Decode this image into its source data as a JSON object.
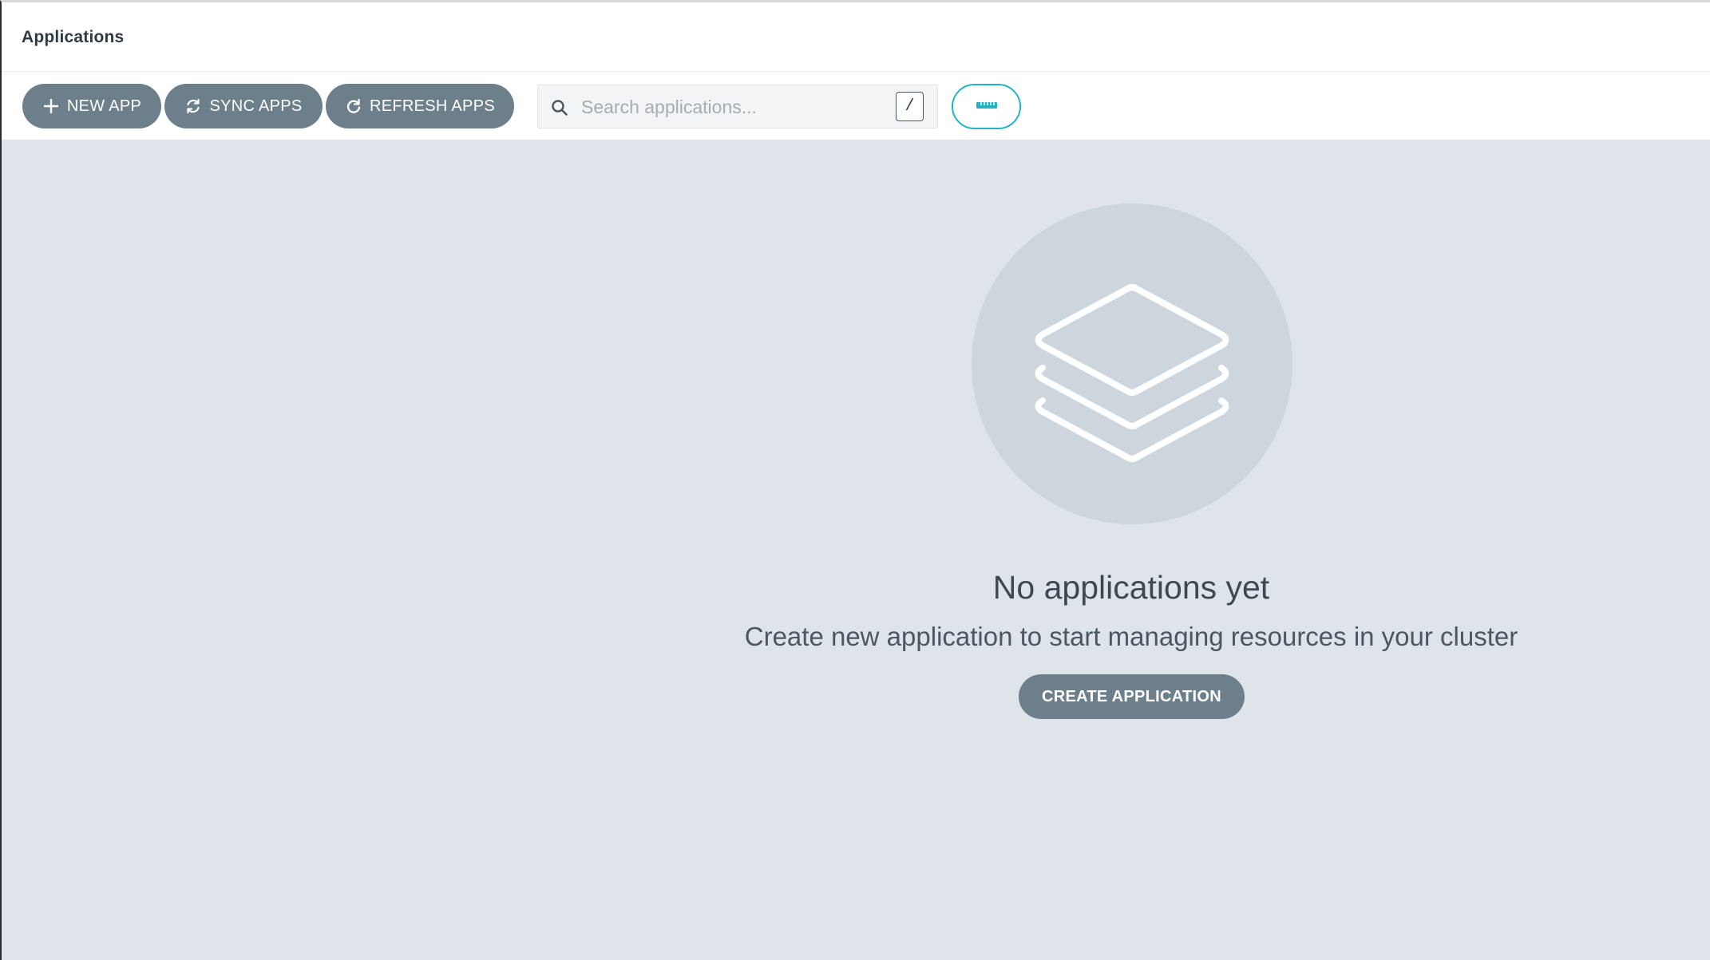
{
  "header": {
    "title": "Applications"
  },
  "toolbar": {
    "new_app": {
      "label": "NEW APP",
      "icon": "plus-icon"
    },
    "sync_apps": {
      "label": "SYNC APPS",
      "icon": "sync-icon"
    },
    "refresh_apps": {
      "label": "REFRESH APPS",
      "icon": "refresh-icon"
    },
    "search": {
      "placeholder": "Search applications...",
      "value": "",
      "shortcut": "/",
      "icon": "search-icon"
    },
    "view_toggle": {
      "icon": "view-mode-icon",
      "accent": "#22b3c5"
    }
  },
  "empty_state": {
    "icon": "layers-icon",
    "title": "No applications yet",
    "subtitle": "Create new application to start managing resources in your cluster",
    "create_button": "CREATE APPLICATION"
  },
  "colors": {
    "button_bg": "#6d7f8b",
    "content_bg": "#dee4ea",
    "accent": "#22b3c5",
    "illustration_bg": "#cdd6dd"
  }
}
